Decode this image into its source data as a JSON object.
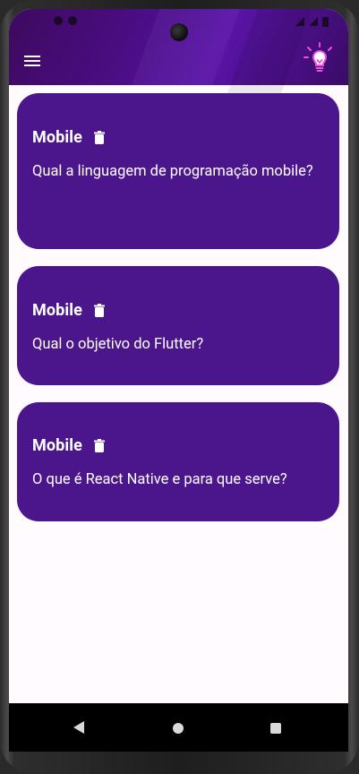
{
  "statusbar": {
    "left_icons": [
      "notification-icon",
      "notification-icon"
    ],
    "right_icons": [
      "wifi-icon",
      "signal-icon",
      "battery-icon"
    ]
  },
  "appbar": {
    "menu_icon": "menu-icon",
    "action_icon": "lightbulb-icon",
    "colors": {
      "gradient_start": "#3d0a5e",
      "gradient_mid": "#5a14a8",
      "action_icon": "#f04ee0"
    }
  },
  "cards": [
    {
      "title": "Mobile",
      "question": "Qual a linguagem de programação mobile?",
      "delete_icon": "trash-icon"
    },
    {
      "title": "Mobile",
      "question": "Qual o objetivo do Flutter?",
      "delete_icon": "trash-icon"
    },
    {
      "title": "Mobile",
      "question": "O que é React Native e para que serve?",
      "delete_icon": "trash-icon"
    }
  ],
  "theme": {
    "card_color": "#4b168c",
    "background": "#fffbfe",
    "text_on_card": "#ffffff"
  },
  "navbar": {
    "icons": [
      "back-icon",
      "home-icon",
      "recents-icon"
    ]
  }
}
